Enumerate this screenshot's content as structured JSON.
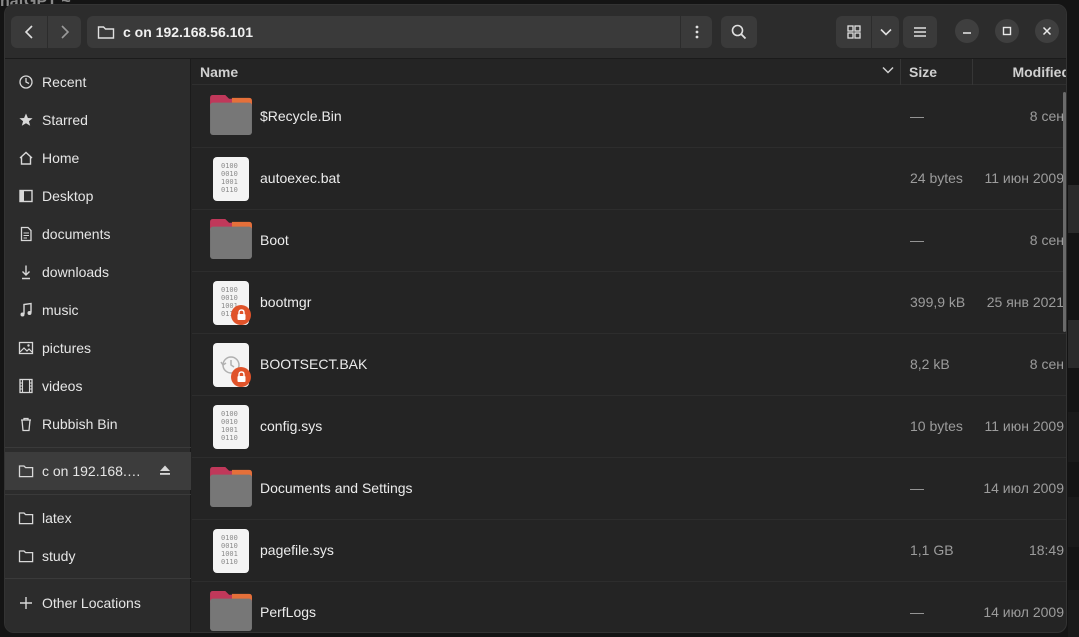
{
  "behind": {
    "title_fragment": "hatGPT ~"
  },
  "header": {
    "path": "c on 192.168.56.101"
  },
  "sidebar": {
    "items": [
      {
        "label": "Recent",
        "icon": "clock-icon"
      },
      {
        "label": "Starred",
        "icon": "star-icon"
      },
      {
        "label": "Home",
        "icon": "home-icon"
      },
      {
        "label": "Desktop",
        "icon": "desktop-icon"
      },
      {
        "label": "documents",
        "icon": "document-icon"
      },
      {
        "label": "downloads",
        "icon": "download-icon"
      },
      {
        "label": "music",
        "icon": "music-icon"
      },
      {
        "label": "pictures",
        "icon": "picture-icon"
      },
      {
        "label": "videos",
        "icon": "video-icon"
      },
      {
        "label": "Rubbish Bin",
        "icon": "trash-icon"
      }
    ],
    "mount": {
      "label": "c on 192.168.…",
      "icon": "folder-icon"
    },
    "bookmarks": [
      {
        "label": "latex",
        "icon": "folder-icon"
      },
      {
        "label": "study",
        "icon": "folder-icon"
      }
    ],
    "other": {
      "label": "Other Locations",
      "icon": "plus-icon"
    }
  },
  "columns": {
    "name": "Name",
    "size": "Size",
    "modified": "Modified"
  },
  "files": [
    {
      "name": "$Recycle.Bin",
      "size": "—",
      "modified": "8 сен",
      "type": "folder",
      "locked": false
    },
    {
      "name": "autoexec.bat",
      "size": "24 bytes",
      "modified": "11 июн 2009",
      "type": "binary",
      "locked": false
    },
    {
      "name": "Boot",
      "size": "—",
      "modified": "8 сен",
      "type": "folder",
      "locked": false
    },
    {
      "name": "bootmgr",
      "size": "399,9 kB",
      "modified": "25 янв 2021",
      "type": "binary",
      "locked": true
    },
    {
      "name": "BOOTSECT.BAK",
      "size": "8,2 kB",
      "modified": "8 сен",
      "type": "backup",
      "locked": true
    },
    {
      "name": "config.sys",
      "size": "10 bytes",
      "modified": "11 июн 2009",
      "type": "binary",
      "locked": false
    },
    {
      "name": "Documents and Settings",
      "size": "—",
      "modified": "14 июл 2009",
      "type": "folder",
      "locked": false
    },
    {
      "name": "pagefile.sys",
      "size": "1,1 GB",
      "modified": "18:49",
      "type": "binary",
      "locked": false
    },
    {
      "name": "PerfLogs",
      "size": "—",
      "modified": "14 июл 2009",
      "type": "folder",
      "locked": false
    }
  ],
  "colors": {
    "folder_top": "#c0385a",
    "folder_tab": "#e5703a",
    "folder_body": "#777777",
    "lock_badge": "#e0532a"
  }
}
